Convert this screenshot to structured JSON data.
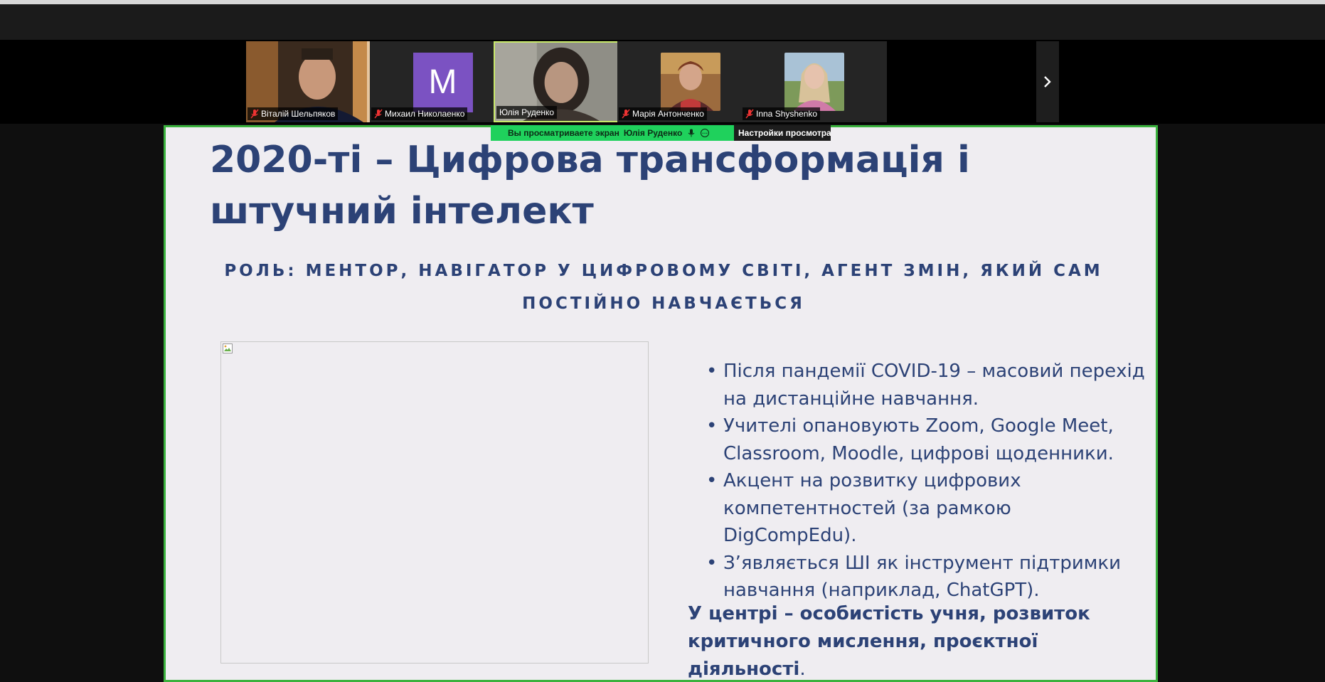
{
  "participants": [
    {
      "name": "Віталій Шельпяков",
      "muted": true,
      "type": "video"
    },
    {
      "name": "Михаил Николаенко",
      "muted": true,
      "type": "avatar",
      "initial": "M",
      "avatar_color": "#7b52c2"
    },
    {
      "name": "Юлія Руденко",
      "muted": false,
      "type": "video",
      "active_speaker": true
    },
    {
      "name": "Марія Антонченко",
      "muted": true,
      "type": "video"
    },
    {
      "name": "Inna Shyshenko",
      "muted": true,
      "type": "video"
    }
  ],
  "strip_next_icon": "chevron-right-icon",
  "share_banner": {
    "text": "Вы просматриваете экран",
    "presenter": "Юлія Руденко",
    "settings_label": "Настройки просмотра",
    "color": "#1fd15c"
  },
  "slide": {
    "title": "2020-ті – Цифрова трансформація і штучний інтелект",
    "subtitle": "РОЛЬ: МЕНТОР, НАВІГАТОР У ЦИФРОВОМУ СВІТІ, АГЕНТ ЗМІН, ЯКИЙ САМ ПОСТІЙНО НАВЧАЄТЬСЯ",
    "bullets": [
      "Після пандемії COVID-19 – масовий перехід на дистанційне навчання.",
      "Учителі опановують Zoom, Google Meet, Classroom, Moodle, цифрові щоденники.",
      "Акцент на розвитку цифрових компетентностей (за рамкою DigCompEdu).",
      "З’являється ШІ як інструмент підтримки навчання (наприклад, ChatGPT)."
    ],
    "conclusion": "У центрі – особистість учня, розвиток критичного мислення, проєктної діяльності",
    "conclusion_end": ".",
    "text_color": "#2c4276",
    "frame_color": "#3ab13d"
  }
}
